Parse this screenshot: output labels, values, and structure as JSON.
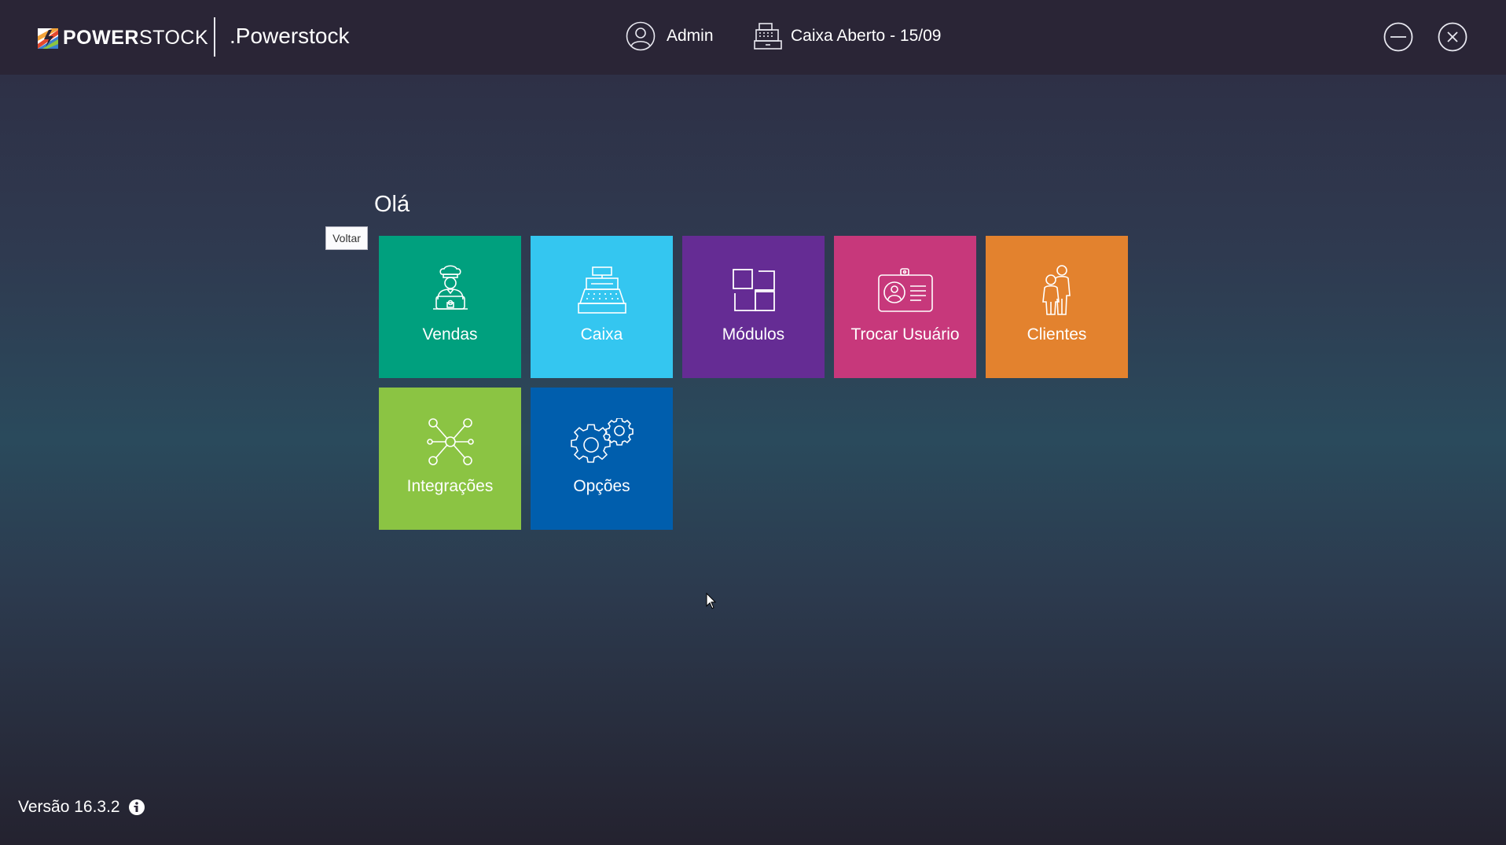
{
  "header": {
    "brand_bold": "POWER",
    "brand_rest": "STOCK",
    "app_name": ".Powerstock",
    "user_name": "Admin",
    "register_status": "Caixa Aberto - 15/09"
  },
  "main": {
    "greeting": "Olá",
    "back_tooltip": "Voltar",
    "tiles": [
      {
        "label": "Vendas",
        "color": "#00a07e",
        "icon": "chef-laptop-icon"
      },
      {
        "label": "Caixa",
        "color": "#34c6f0",
        "icon": "cash-register-icon"
      },
      {
        "label": "Módulos",
        "color": "#652c94",
        "icon": "modules-icon"
      },
      {
        "label": "Trocar Usuário",
        "color": "#c7387b",
        "icon": "id-badge-icon"
      },
      {
        "label": "Clientes",
        "color": "#e3822e",
        "icon": "people-icon"
      },
      {
        "label": "Integrações",
        "color": "#8bc443",
        "icon": "network-icon"
      },
      {
        "label": "Opções",
        "color": "#005ead",
        "icon": "gears-icon"
      }
    ]
  },
  "footer": {
    "version": "Versão 16.3.2"
  }
}
